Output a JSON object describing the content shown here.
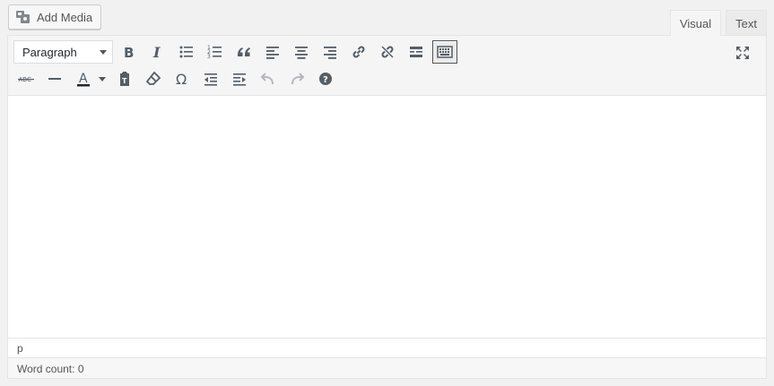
{
  "media": {
    "add_label": "Add Media",
    "icon": "media-icon"
  },
  "tabs": [
    {
      "label": "Visual",
      "active": true
    },
    {
      "label": "Text",
      "active": false
    }
  ],
  "toolbar": {
    "format_value": "Paragraph",
    "row1": [
      "bold-icon",
      "italic-icon",
      "bullet-list-icon",
      "numbered-list-icon",
      "blockquote-icon",
      "align-left-icon",
      "align-center-icon",
      "align-right-icon",
      "link-icon",
      "unlink-icon",
      "read-more-icon",
      "toolbar-toggle-icon"
    ],
    "row2": [
      "strikethrough-icon",
      "horizontal-line-icon",
      "text-color-icon",
      "paste-text-icon",
      "clear-format-icon",
      "special-char-icon",
      "outdent-icon",
      "indent-icon",
      "undo-icon",
      "redo-icon",
      "help-icon"
    ],
    "fullscreen": "fullscreen-icon",
    "text_color": "#23282d"
  },
  "editor": {
    "path": "p",
    "word_count_label": "Word count:",
    "word_count": "0"
  },
  "colors": {
    "background": "#f1f1f1",
    "icon": "#555d66",
    "border": "#e5e5e5"
  }
}
